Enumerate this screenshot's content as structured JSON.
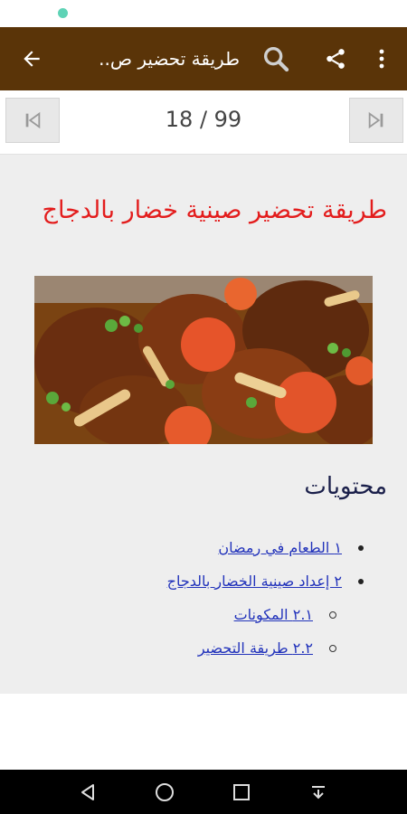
{
  "app_bar": {
    "title": "طريقة تحضير ص..",
    "back_icon": "arrow-left-icon",
    "search_icon": "search-icon",
    "share_icon": "share-icon",
    "menu_icon": "more-vert-icon",
    "background": "#5a3408"
  },
  "pager": {
    "label": "18 / 99",
    "current_page": 18,
    "total_pages": 99,
    "first_icon": "skip-previous-icon",
    "last_icon": "skip-next-icon"
  },
  "article": {
    "title": "طريقة تحضير صينية خضار بالدجاج",
    "title_color": "#e31d1d",
    "image_description_icon": "chicken-vegetables-photo"
  },
  "toc": {
    "heading": "محتويات",
    "items": [
      {
        "label": "١ الطعام في رمضان"
      },
      {
        "label": "٢ إعداد صينية الخضار بالدجاج"
      },
      {
        "label": "٢.١ المكونات"
      },
      {
        "label": "٢.٢ طريقة التحضير"
      }
    ]
  },
  "nav_bar": {
    "back_icon": "triangle-back-icon",
    "home_icon": "circle-home-icon",
    "recent_icon": "square-recents-icon",
    "down_icon": "download-arrow-icon"
  }
}
